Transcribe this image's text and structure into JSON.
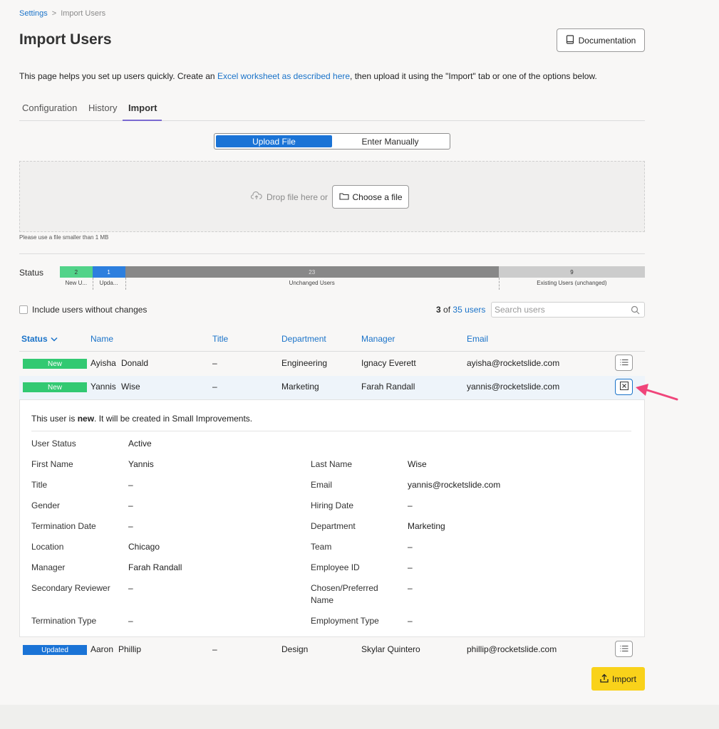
{
  "breadcrumb": {
    "root": "Settings",
    "separator": ">",
    "current": "Import Users"
  },
  "page": {
    "title": "Import Users",
    "documentation_label": "Documentation",
    "intro_before": "This page helps you set up users quickly. Create an ",
    "intro_link": "Excel worksheet as described here",
    "intro_after": ", then upload it using the \"Import\" tab or one of the options below."
  },
  "tabs": [
    {
      "label": "Configuration",
      "active": false
    },
    {
      "label": "History",
      "active": false
    },
    {
      "label": "Import",
      "active": true
    }
  ],
  "upload": {
    "mode_upload": "Upload File",
    "mode_manual": "Enter Manually",
    "drop_text": "Drop file here or",
    "choose_label": "Choose a file",
    "hint": "Please use a file smaller than 1 MB"
  },
  "status": {
    "label": "Status",
    "segments": [
      {
        "count": "2",
        "label": "New U...",
        "value": 2,
        "color": "#52d389"
      },
      {
        "count": "1",
        "label": "Upda...",
        "value": 1,
        "color": "#2d7fde"
      },
      {
        "count": "23",
        "label": "Unchanged Users",
        "value": 23,
        "color": "#888888"
      },
      {
        "count": "9",
        "label": "Existing Users (unchanged)",
        "value": 9,
        "color": "#cccccc"
      }
    ]
  },
  "filters": {
    "include_label": "Include users without changes",
    "count_shown": "3",
    "count_of": "of",
    "count_total": "35 users",
    "search_placeholder": "Search users"
  },
  "table": {
    "headers": {
      "status": "Status",
      "name": "Name",
      "title": "Title",
      "department": "Department",
      "manager": "Manager",
      "email": "Email"
    },
    "rows": [
      {
        "status": "New",
        "first": "Ayisha",
        "last": "Donald",
        "title": "–",
        "department": "Engineering",
        "manager": "Ignacy Everett",
        "email": "ayisha@rocketslide.com"
      },
      {
        "status": "New",
        "first": "Yannis",
        "last": "Wise",
        "title": "–",
        "department": "Marketing",
        "manager": "Farah Randall",
        "email": "yannis@rocketslide.com"
      },
      {
        "status": "Updated",
        "first": "Aaron",
        "last": "Phillip",
        "title": "–",
        "department": "Design",
        "manager": "Skylar Quintero",
        "email": "phillip@rocketslide.com"
      }
    ]
  },
  "detail": {
    "message_before": "This user is ",
    "message_bold": "new",
    "message_after": ". It will be created in Small Improvements.",
    "left": [
      {
        "label": "User Status",
        "value": "Active"
      },
      {
        "label": "First Name",
        "value": "Yannis"
      },
      {
        "label": "Title",
        "value": "–"
      },
      {
        "label": "Gender",
        "value": "–"
      },
      {
        "label": "Termination Date",
        "value": "–"
      },
      {
        "label": "Location",
        "value": "Chicago"
      },
      {
        "label": "Manager",
        "value": "Farah Randall"
      },
      {
        "label": "Secondary Reviewer",
        "value": "–"
      },
      {
        "label": "Termination Type",
        "value": "–"
      }
    ],
    "right": [
      {
        "label": "Last Name",
        "value": "Wise"
      },
      {
        "label": "Email",
        "value": "yannis@rocketslide.com"
      },
      {
        "label": "Hiring Date",
        "value": "–"
      },
      {
        "label": "Department",
        "value": "Marketing"
      },
      {
        "label": "Team",
        "value": "–"
      },
      {
        "label": "Employee ID",
        "value": "–"
      },
      {
        "label": "Chosen/Preferred",
        "label2": "Name",
        "value": "–"
      },
      {
        "label": "Employment Type",
        "value": "–"
      }
    ]
  },
  "actions": {
    "import_label": "Import"
  },
  "colors": {
    "accent": "#1a73c9",
    "new": "#32c972",
    "updated": "#1a73d6",
    "import": "#f9d21a",
    "annotation_arrow": "#f0457a"
  }
}
